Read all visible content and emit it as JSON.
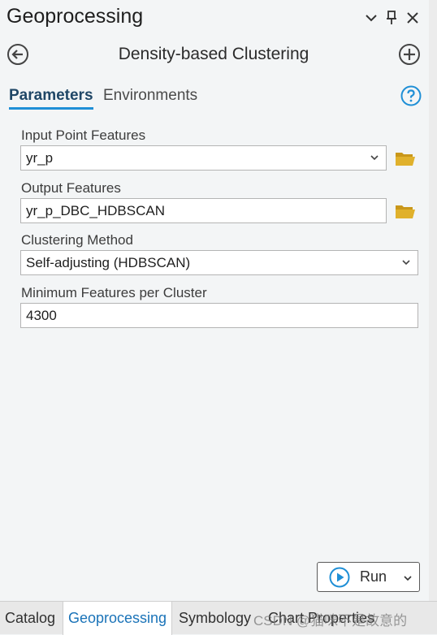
{
  "pane": {
    "title": "Geoprocessing"
  },
  "tool": {
    "title": "Density-based Clustering"
  },
  "tabs": [
    {
      "label": "Parameters"
    },
    {
      "label": "Environments"
    }
  ],
  "params": {
    "input_point_features": {
      "label": "Input Point Features",
      "value": "yr_p"
    },
    "output_features": {
      "label": "Output Features",
      "value": "yr_p_DBC_HDBSCAN"
    },
    "clustering_method": {
      "label": "Clustering Method",
      "value": "Self-adjusting (HDBSCAN)"
    },
    "min_features": {
      "label": "Minimum Features per Cluster",
      "value": "4300"
    }
  },
  "run": {
    "label": "Run"
  },
  "dock_tabs": [
    {
      "label": "Catalog"
    },
    {
      "label": "Geoprocessing"
    },
    {
      "label": "Symbology"
    },
    {
      "label": "Chart Properties"
    }
  ],
  "watermark": "CSDN @猫咪不是故意的",
  "colors": {
    "accent": "#1f8fd6",
    "folder": "#e0b12c",
    "active_tab_text": "#1a73b8"
  },
  "icons": {
    "back": "arrow-left-circle-icon",
    "add": "plus-circle-icon",
    "help": "question-circle-icon",
    "folder": "folder-open-icon",
    "run": "play-circle-icon"
  }
}
